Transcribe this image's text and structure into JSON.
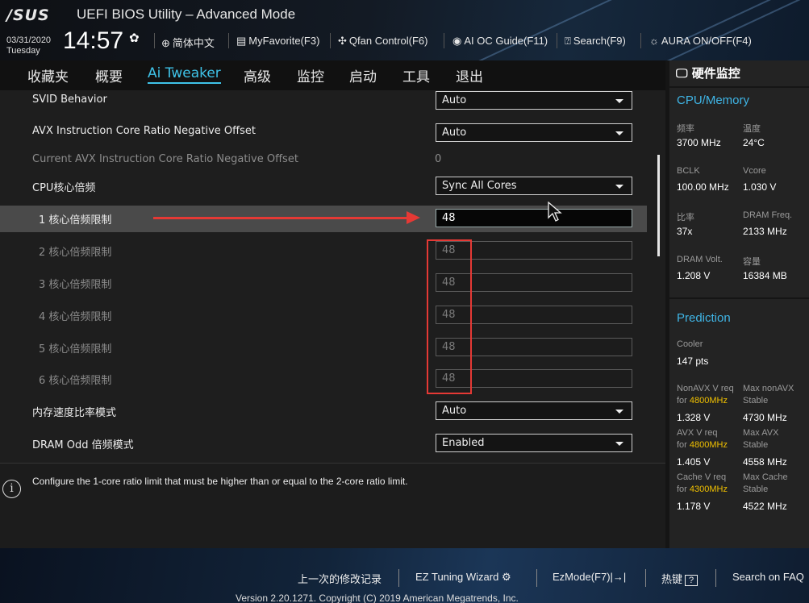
{
  "header": {
    "logo": "/SUS",
    "title": "UEFI BIOS Utility – Advanced Mode",
    "date": "03/31/2020",
    "weekday": "Tuesday",
    "time": "14:57",
    "toolbar": [
      {
        "label": "简体中文",
        "icon": "globe-icon"
      },
      {
        "label": "MyFavorite(F3)",
        "icon": "favorite-icon"
      },
      {
        "label": "Qfan Control(F6)",
        "icon": "fan-icon"
      },
      {
        "label": "AI OC Guide(F11)",
        "icon": "ai-icon"
      },
      {
        "label": "Search(F9)",
        "icon": "search-icon"
      },
      {
        "label": "AURA ON/OFF(F4)",
        "icon": "aura-icon"
      }
    ]
  },
  "nav": {
    "tabs": [
      "收藏夹",
      "概要",
      "Ai Tweaker",
      "高级",
      "监控",
      "启动",
      "工具",
      "退出"
    ],
    "active": "Ai Tweaker"
  },
  "settings": {
    "svid_label": "SVID Behavior",
    "svid_value": "Auto",
    "avx_label": "AVX Instruction Core Ratio Negative Offset",
    "avx_value": "Auto",
    "cur_avx_label": "Current AVX Instruction Core Ratio Negative Offset",
    "cur_avx_value": "0",
    "cpu_ratio_label": "CPU核心倍频",
    "cpu_ratio_value": "Sync All Cores",
    "core_limits": [
      {
        "label": "1 核心倍频限制",
        "value": "48"
      },
      {
        "label": "2 核心倍频限制",
        "value": "48"
      },
      {
        "label": "3 核心倍频限制",
        "value": "48"
      },
      {
        "label": "4 核心倍频限制",
        "value": "48"
      },
      {
        "label": "5 核心倍频限制",
        "value": "48"
      },
      {
        "label": "6 核心倍频限制",
        "value": "48"
      }
    ],
    "mem_mode_label": "内存速度比率模式",
    "mem_mode_value": "Auto",
    "dram_odd_label": "DRAM Odd 倍频模式",
    "dram_odd_value": "Enabled"
  },
  "help": {
    "text": "Configure the 1-core ratio limit that must be higher than or equal to the 2-core ratio limit."
  },
  "monitor": {
    "title": "硬件监控",
    "cpu_section": "CPU/Memory",
    "freq_label": "频率",
    "freq": "3700 MHz",
    "temp_label": "温度",
    "temp": "24°C",
    "bclk_label": "BCLK",
    "bclk": "100.00 MHz",
    "vcore_label": "Vcore",
    "vcore": "1.030 V",
    "ratio_label": "比率",
    "ratio": "37x",
    "dram_freq_label": "DRAM Freq.",
    "dram_freq": "2133 MHz",
    "dram_volt_label": "DRAM Volt.",
    "dram_volt": "1.208 V",
    "capacity_label": "容量",
    "capacity": "16384 MB",
    "pred_section": "Prediction",
    "cooler_label": "Cooler",
    "cooler": "147 pts",
    "nonavx_req_label": "NonAVX V req",
    "for_label": "for",
    "nonavx_freq": "4800MHz",
    "nonavx_v": "1.328 V",
    "max_nonavx_label": "Max nonAVX",
    "stable_label": "Stable",
    "max_nonavx": "4730 MHz",
    "avx_req_label": "AVX V req",
    "avx_freq": "4800MHz",
    "avx_v": "1.405 V",
    "max_avx_label": "Max AVX",
    "max_avx": "4558 MHz",
    "cache_req_label": "Cache V req",
    "cache_freq": "4300MHz",
    "cache_v": "1.178 V",
    "max_cache_label": "Max Cache",
    "max_cache": "4522 MHz"
  },
  "footer": {
    "last_mod": "上一次的修改记录",
    "ez_tuning": "EZ Tuning Wizard",
    "ezmode": "EzMode(F7)|→|",
    "hotkeys": "热键",
    "hotkeys_key": "?",
    "faq": "Search on FAQ",
    "version": "Version 2.20.1271. Copyright (C) 2019 American Megatrends, Inc."
  },
  "colors": {
    "accent": "#3fc3e8",
    "highlight": "#f0c000",
    "annotation": "#e53935"
  }
}
